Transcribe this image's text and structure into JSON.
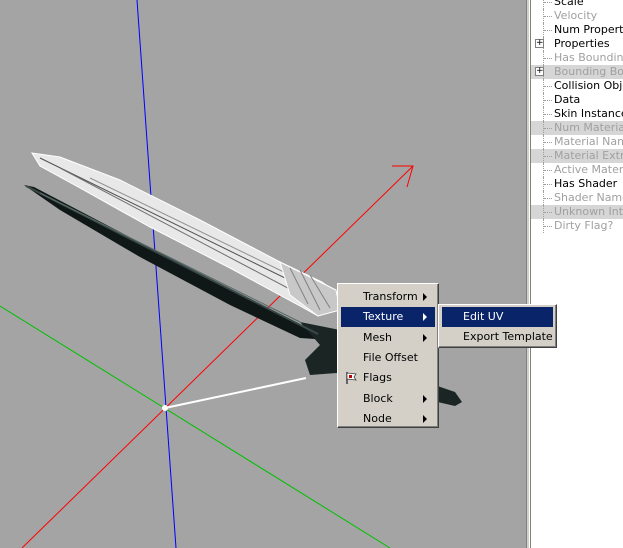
{
  "tree": {
    "items": [
      {
        "label": "Scale",
        "state": "normal",
        "expander": ""
      },
      {
        "label": "Velocity",
        "state": "disabled",
        "expander": ""
      },
      {
        "label": "Num Properties",
        "state": "normal",
        "expander": ""
      },
      {
        "label": "Properties",
        "state": "normal",
        "expander": "+"
      },
      {
        "label": "Has Boundin...",
        "state": "disabled",
        "expander": ""
      },
      {
        "label": "Bounding Box",
        "state": "highlight-disabled",
        "expander": "+"
      },
      {
        "label": "Collision Object",
        "state": "normal",
        "expander": ""
      },
      {
        "label": "Data",
        "state": "normal",
        "expander": ""
      },
      {
        "label": "Skin Instance",
        "state": "normal",
        "expander": ""
      },
      {
        "label": "Num Materials",
        "state": "highlight-disabled",
        "expander": ""
      },
      {
        "label": "Material Name",
        "state": "disabled",
        "expander": ""
      },
      {
        "label": "Material Extr...",
        "state": "highlight-disabled",
        "expander": ""
      },
      {
        "label": "Active Material",
        "state": "disabled",
        "expander": ""
      },
      {
        "label": "Has Shader",
        "state": "normal",
        "expander": ""
      },
      {
        "label": "Shader Name",
        "state": "disabled",
        "expander": ""
      },
      {
        "label": "Unknown Int...",
        "state": "highlight-disabled",
        "expander": ""
      },
      {
        "label": "Dirty Flag?",
        "state": "disabled",
        "expander": ""
      }
    ]
  },
  "context_menu": {
    "items": [
      {
        "label": "Transform",
        "submenu": true,
        "icon": ""
      },
      {
        "label": "Texture",
        "submenu": true,
        "icon": "",
        "selected": true
      },
      {
        "label": "Mesh",
        "submenu": true,
        "icon": ""
      },
      {
        "label": "File Offset",
        "submenu": false,
        "icon": ""
      },
      {
        "label": "Flags",
        "submenu": false,
        "icon": "flag-icon"
      },
      {
        "label": "Block",
        "submenu": true,
        "icon": ""
      },
      {
        "label": "Node",
        "submenu": true,
        "icon": ""
      }
    ]
  },
  "submenu": {
    "items": [
      {
        "label": "Edit UV",
        "selected": true
      },
      {
        "label": "Export Template",
        "selected": false
      }
    ]
  },
  "colors": {
    "viewport_bg": "#a4a4a4",
    "axis_x": "#ff0000",
    "axis_y": "#00c000",
    "axis_z": "#0000ff",
    "menu_highlight": "#0a246a"
  }
}
